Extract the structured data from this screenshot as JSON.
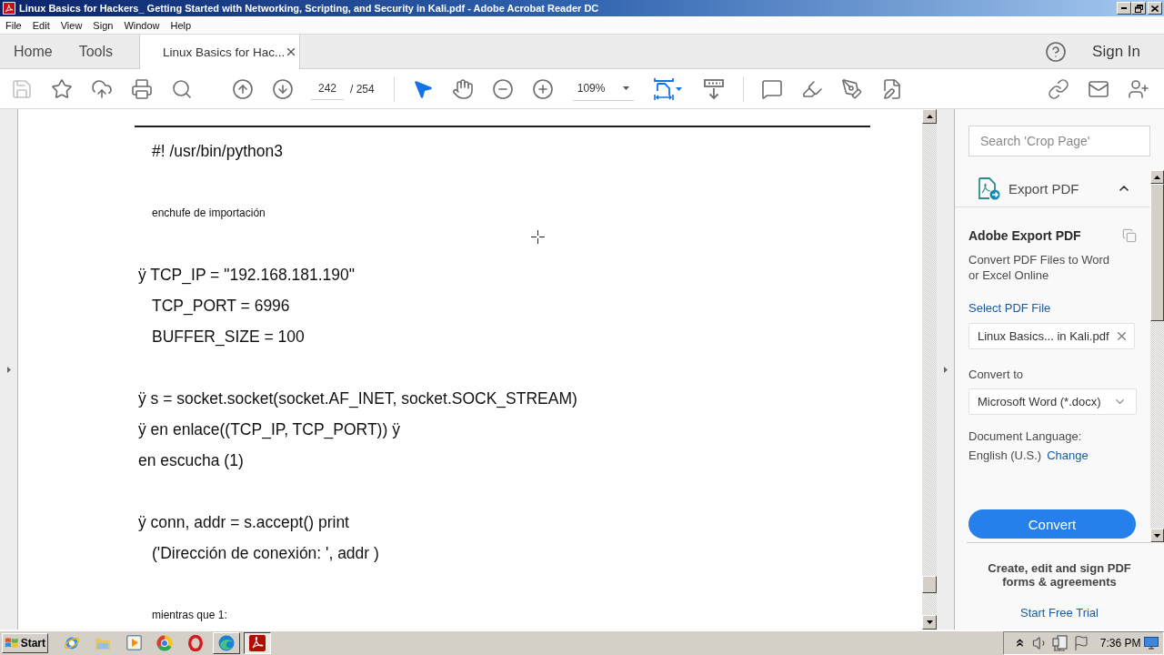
{
  "window": {
    "title": "Linux Basics for Hackers_ Getting Started with Networking, Scripting, and Security in Kali.pdf - Adobe Acrobat Reader DC"
  },
  "menu_bar": [
    "File",
    "Edit",
    "View",
    "Sign",
    "Window",
    "Help"
  ],
  "tabs": [
    {
      "kind": "nav",
      "label": "Home",
      "selected": false
    },
    {
      "kind": "nav",
      "label": "Tools",
      "selected": false
    },
    {
      "kind": "document",
      "label": "Linux Basics for Hac...",
      "selected": true
    }
  ],
  "account": {
    "sign_in": "Sign In"
  },
  "toolbar": {
    "save": {
      "disabled": true
    },
    "page_number": "242",
    "page_count": "/ 254",
    "pointer_tools": [
      {
        "selected": true
      },
      {
        "selected": false
      }
    ],
    "zoom": "109%"
  },
  "document": {
    "blocks": [
      {
        "lines": [
          {
            "kind": "code",
            "text": "#! /usr/bin/python3"
          }
        ]
      },
      {
        "lines": [
          {
            "kind": "note",
            "text": "enchufe de importación"
          }
        ]
      },
      {
        "lines": [
          {
            "kind": "hanging",
            "text": "ÿ TCP_IP = \"192.168.181.190\""
          },
          {
            "kind": "code",
            "text": "TCP_PORT = 6996"
          },
          {
            "kind": "code",
            "text": "BUFFER_SIZE = 100"
          }
        ]
      },
      {
        "lines": [
          {
            "kind": "hanging",
            "text": "ÿ s = socket.socket(socket.AF_INET, socket.SOCK_STREAM)"
          },
          {
            "kind": "hanging",
            "text": "ÿ en enlace((TCP_IP, TCP_PORT)) ÿ"
          },
          {
            "kind": "hanging",
            "text": "en escucha (1)"
          }
        ]
      },
      {
        "lines": [
          {
            "kind": "hanging",
            "text": "ÿ conn, addr = s.accept() print"
          },
          {
            "kind": "code",
            "text": "('Dirección de conexión: ', addr )"
          }
        ]
      },
      {
        "lines": [
          {
            "kind": "note",
            "text": "mientras que 1:"
          }
        ]
      }
    ]
  },
  "side_panel": {
    "search": {
      "placeholder": "Search 'Crop Page'"
    },
    "section": {
      "title": "Export PDF",
      "expanded": true
    },
    "heading": "Adobe Export PDF",
    "description": "Convert PDF Files to Word or Excel Online",
    "select_file_link": "Select PDF File",
    "file": {
      "value": "Linux Basics... in Kali.pdf"
    },
    "convert_to_label": "Convert to",
    "format": {
      "value": "Microsoft Word (*.docx)"
    },
    "language_label": "Document Language:",
    "language": "English (U.S.)",
    "change_link": "Change",
    "convert_button": "Convert",
    "promo": {
      "text": "Create, edit and sign PDF forms & agreements",
      "link": "Start Free Trial"
    }
  },
  "taskbar": {
    "start": "Start",
    "apps": [
      {
        "kind": "globe",
        "open": false,
        "selected": false
      },
      {
        "kind": "folder",
        "open": false,
        "selected": false
      },
      {
        "kind": "player",
        "open": false,
        "selected": false
      },
      {
        "kind": "wheel",
        "open": false,
        "selected": false
      },
      {
        "kind": "ring",
        "open": false,
        "selected": false
      },
      {
        "kind": "swirl",
        "open": true,
        "selected": false
      },
      {
        "kind": "pdf",
        "open": true,
        "selected": true
      }
    ],
    "clock": "7:36 PM"
  }
}
